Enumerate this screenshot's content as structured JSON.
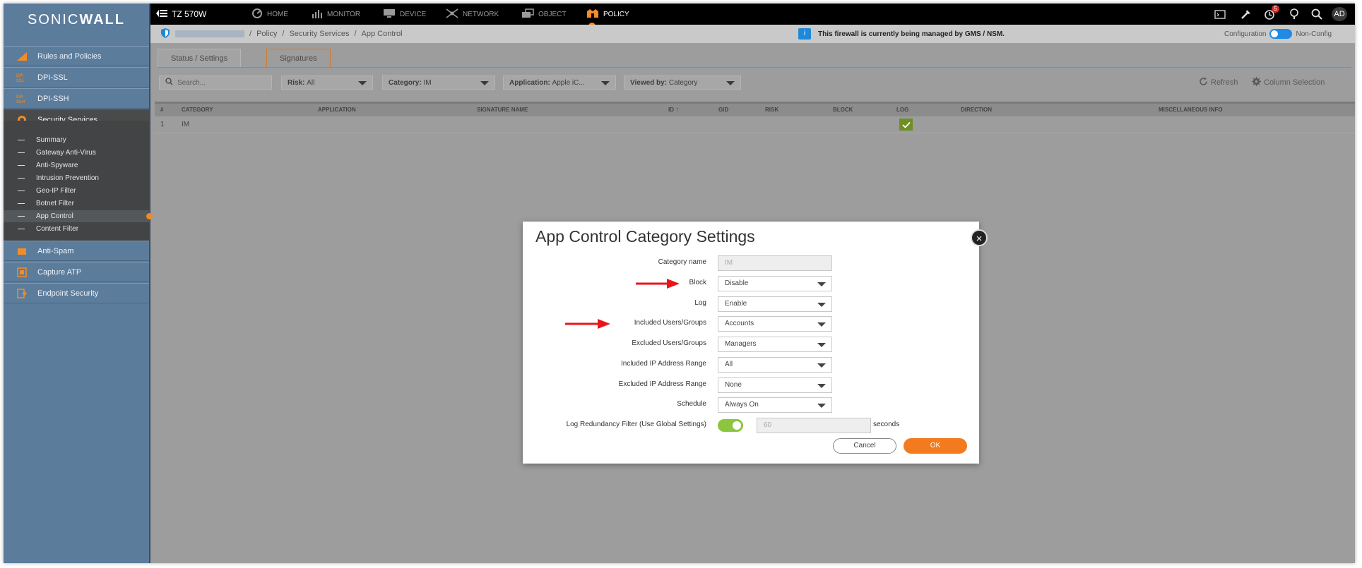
{
  "logo": {
    "text_left": "SONIC",
    "text_right": "WALL"
  },
  "sidebar": {
    "items": [
      {
        "label": "Rules and Policies",
        "icon": "rules-icon"
      },
      {
        "label": "DPI-SSL",
        "icon": "dpi-ssl-icon"
      },
      {
        "label": "DPI-SSH",
        "icon": "dpi-ssh-icon"
      },
      {
        "label": "Security Services",
        "icon": "security-services-icon"
      },
      {
        "label": "Anti-Spam",
        "icon": "anti-spam-icon"
      },
      {
        "label": "Capture ATP",
        "icon": "capture-atp-icon"
      },
      {
        "label": "Endpoint Security",
        "icon": "endpoint-security-icon"
      }
    ],
    "subitems": [
      "Summary",
      "Gateway Anti-Virus",
      "Anti-Spyware",
      "Intrusion Prevention",
      "Geo-IP Filter",
      "Botnet Filter",
      "App Control",
      "Content Filter"
    ]
  },
  "topbar": {
    "device": "TZ 570W",
    "nav": [
      "HOME",
      "MONITOR",
      "DEVICE",
      "NETWORK",
      "OBJECT",
      "POLICY"
    ],
    "notification_count": "5",
    "avatar": "AD"
  },
  "breadcrumb": {
    "items": [
      "Policy",
      "Security Services",
      "App Control"
    ],
    "separator": "/",
    "gms_message": "This firewall is currently being managed by GMS / NSM.",
    "config_label": "Configuration",
    "nonconfig_label": "Non-Config"
  },
  "tabs": [
    "Status / Settings",
    "Signatures"
  ],
  "filters": {
    "search_placeholder": "Search...",
    "risk": {
      "label": "Risk:",
      "value": "All"
    },
    "category": {
      "label": "Category:",
      "value": "IM"
    },
    "application": {
      "label": "Application:",
      "value": "Apple iC..."
    },
    "viewed_by": {
      "label": "Viewed by:",
      "value": "Category"
    },
    "refresh": "Refresh",
    "column_selection": "Column Selection"
  },
  "table": {
    "headers": [
      "#",
      "CATEGORY",
      "APPLICATION",
      "SIGNATURE NAME",
      "ID",
      "GID",
      "RISK",
      "BLOCK",
      "LOG",
      "DIRECTION",
      "MISCELLANEOUS INFO"
    ],
    "rows": [
      {
        "num": "1",
        "category": "IM"
      }
    ]
  },
  "modal": {
    "title": "App Control Category Settings",
    "fields": [
      {
        "label": "Category name",
        "value": "IM"
      },
      {
        "label": "Block",
        "value": "Disable"
      },
      {
        "label": "Log",
        "value": "Enable"
      },
      {
        "label": "Included Users/Groups",
        "value": "Accounts"
      },
      {
        "label": "Excluded Users/Groups",
        "value": "Managers"
      },
      {
        "label": "Included IP Address Range",
        "value": "All"
      },
      {
        "label": "Excluded IP Address Range",
        "value": "None"
      },
      {
        "label": "Schedule",
        "value": "Always On"
      }
    ],
    "log_redundancy": {
      "label": "Log Redundancy Filter (Use Global Settings)",
      "value": "60",
      "unit": "seconds"
    },
    "cancel": "Cancel",
    "ok": "OK"
  },
  "colors": {
    "accent": "#f47a20",
    "sidebar": "#5c7c9c",
    "toggle_on": "#8cc63f",
    "annotation_arrow": "#e8161b"
  }
}
